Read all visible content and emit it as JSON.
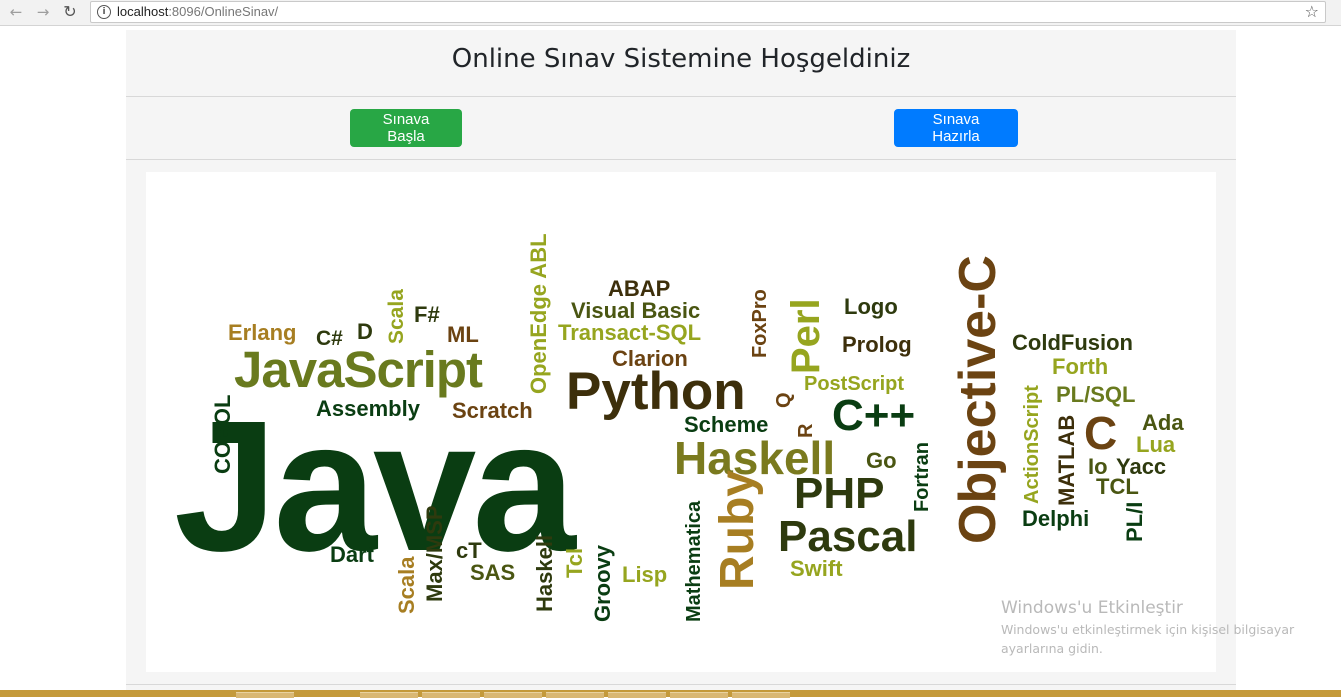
{
  "browser": {
    "url_host": "localhost",
    "url_rest": ":8096/OnlineSinav/"
  },
  "page": {
    "title": "Online Sınav Sistemine Hoşgeldiniz",
    "start_button": "Sınava Başla",
    "prepare_button": "Sınava Hazırla"
  },
  "word_cloud": {
    "words": [
      "Java",
      "JavaScript",
      "Python",
      "Haskell",
      "Pascal",
      "PHP",
      "Ruby",
      "Objective-C",
      "C++",
      "Perl",
      "C",
      "Erlang",
      "C#",
      "D",
      "F#",
      "ML",
      "Scala",
      "OpenEdge ABL",
      "ABAP",
      "Visual Basic",
      "Transact-SQL",
      "FoxPro",
      "Logo",
      "Prolog",
      "Clarion",
      "PostScript",
      "ColdFusion",
      "Forth",
      "PL/SQL",
      "Ada",
      "Lua",
      "Yacc",
      "Io",
      "TCL",
      "Delphi",
      "PL/I",
      "MATLAB",
      "ActionScript",
      "Go",
      "Fortran",
      "Scheme",
      "R",
      "Q",
      "Assembly",
      "Scratch",
      "COBOL",
      "Dart",
      "Scala",
      "Max/MSP",
      "cT",
      "SAS",
      "Haskell",
      "Tcl",
      "Groovy",
      "Lisp",
      "Mathematica",
      "Swift"
    ]
  },
  "watermark": {
    "title": "Windows'u Etkinleştir",
    "subtitle": "Windows'u etkinleştirmek için kişisel bilgisayar ayarlarına gidin."
  }
}
